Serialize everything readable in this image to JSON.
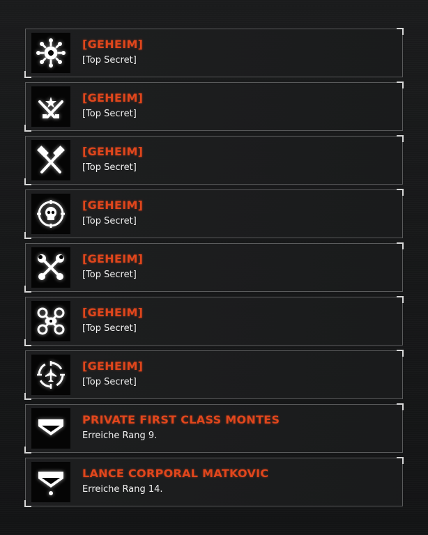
{
  "achievements": [
    {
      "title": "[GEHEIM]",
      "desc": "[Top Secret]",
      "icon": "spiked-sun-icon"
    },
    {
      "title": "[GEHEIM]",
      "desc": "[Top Secret]",
      "icon": "crossed-knives-star-icon"
    },
    {
      "title": "[GEHEIM]",
      "desc": "[Top Secret]",
      "icon": "crossed-hammers-icon"
    },
    {
      "title": "[GEHEIM]",
      "desc": "[Top Secret]",
      "icon": "skull-target-icon"
    },
    {
      "title": "[GEHEIM]",
      "desc": "[Top Secret]",
      "icon": "crossed-wrenches-icon"
    },
    {
      "title": "[GEHEIM]",
      "desc": "[Top Secret]",
      "icon": "drone-icon"
    },
    {
      "title": "[GEHEIM]",
      "desc": "[Top Secret]",
      "icon": "crosshair-aircraft-icon"
    },
    {
      "title": "PRIVATE FIRST CLASS MONTES",
      "desc": "Erreiche Rang 9.",
      "icon": "rank-chevron-icon"
    },
    {
      "title": "LANCE CORPORAL MATKOVIC",
      "desc": "Erreiche Rang 14.",
      "icon": "rank-chevron-dot-icon"
    }
  ],
  "colors": {
    "title": "#e0461c",
    "text": "#f0f0f0",
    "border": "#5a5b5c"
  }
}
